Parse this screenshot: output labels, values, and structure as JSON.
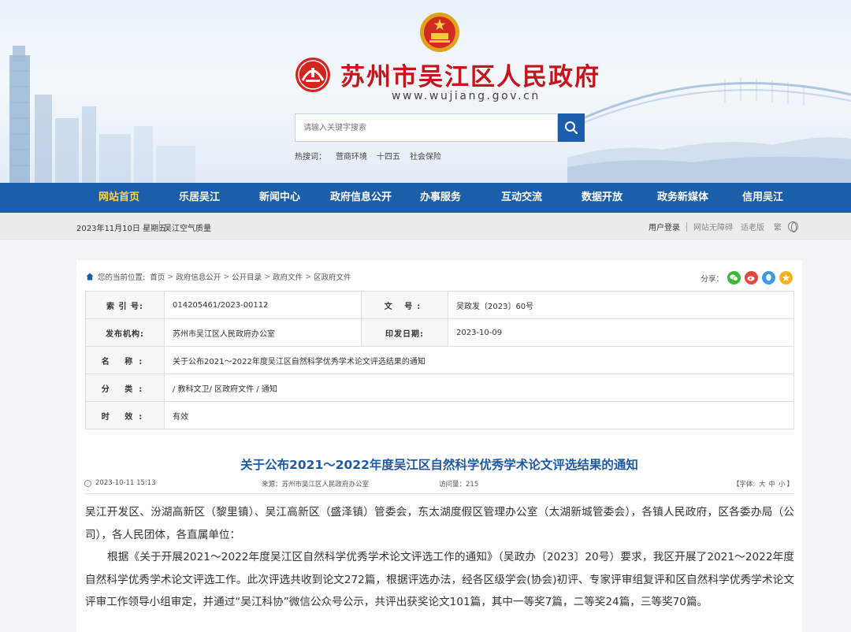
{
  "header": {
    "site_title": "苏州市吴江区人民政府",
    "site_url": "www.wujiang.gov.cn",
    "search_placeholder": "请输入关键字搜索",
    "hotwords_label": "热搜词：",
    "hotwords": [
      "营商环境",
      "十四五",
      "社会保险"
    ]
  },
  "nav": {
    "items": [
      "网站首页",
      "乐居吴江",
      "新闻中心",
      "政府信息公开",
      "办事服务",
      "互动交流",
      "数据开放",
      "政务新媒体",
      "信用吴江"
    ],
    "active_index": 0
  },
  "subbar": {
    "date": "2023年11月10日 星期五",
    "air_quality": "吴江空气质量",
    "login": "用户登录",
    "accessibility": "网站无障碍",
    "elder": "适老版",
    "traditional": "繁"
  },
  "breadcrumb": {
    "prefix": "您的当前位置:",
    "items": [
      "首页",
      "政府信息公开",
      "公开目录",
      "政府文件",
      "区政府文件"
    ],
    "sep": ">"
  },
  "share": {
    "label": "分享：",
    "icons": [
      "wechat-icon",
      "weibo-icon",
      "qq-icon",
      "favorite-icon"
    ]
  },
  "meta": {
    "index_label": "索 引 号:",
    "index_value": "014205461/2023-00112",
    "docno_label": "文 号:",
    "docno_value": "吴政发〔2023〕60号",
    "org_label": "发布机构:",
    "org_value": "苏州市吴江区人民政府办公室",
    "date_label": "印发日期:",
    "date_value": "2023-10-09",
    "name_label": "名 称:",
    "name_value": "关于公布2021～2022年度吴江区自然科学优秀学术论文评选结果的通知",
    "category_label": "分 类:",
    "category_value": "/ 教科文卫/ 区政府文件 / 通知",
    "validity_label": "时 效:",
    "validity_value": "有效"
  },
  "document": {
    "title": "关于公布2021～2022年度吴江区自然科学优秀学术论文评选结果的通知",
    "published": "2023-10-11 15:13",
    "source": "来源：苏州市吴江区人民政府办公室",
    "views": "访问量：215",
    "font_label_open": "【字体:",
    "font_big": "大",
    "font_mid": "中",
    "font_small": "小",
    "font_label_close": "】",
    "para1": "吴江开发区、汾湖高新区（黎里镇）、吴江高新区（盛泽镇）管委会，东太湖度假区管理办公室（太湖新城管委会），各镇人民政府，区各委办局（公司），各人民团体，各直属单位：",
    "para2": "根据《关于开展2021～2022年度吴江区自然科学优秀学术论文评选工作的通知》（吴政办〔2023〕20号）要求，我区开展了2021～2022年度自然科学优秀学术论文评选工作。此次评选共收到论文272篇，根据评选办法，经各区级学会(协会)初评、专家评审组复评和区自然科学优秀学术论文评审工作领导小组审定，并通过“吴江科协”微信公众号公示，共评出获奖论文101篇，其中一等奖7篇，二等奖24篇，三等奖70篇。"
  },
  "colors": {
    "brand_red": "#c4161c",
    "nav_blue": "#1b5eaa",
    "nav_active": "#ffd34d",
    "title_blue": "#1f5aa6"
  }
}
